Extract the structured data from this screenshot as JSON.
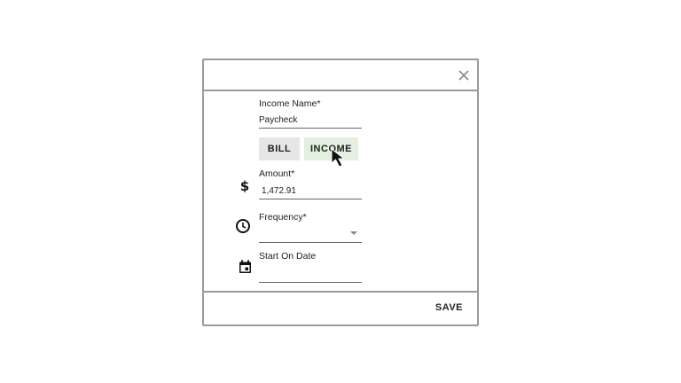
{
  "dialog": {
    "income_name": {
      "label": "Income Name*",
      "value": "Paycheck"
    },
    "type_toggle": {
      "bill_label": "BILL",
      "income_label": "INCOME",
      "selected": "INCOME"
    },
    "amount": {
      "label": "Amount*",
      "value": "1,472.91",
      "icon": "dollar-icon"
    },
    "frequency": {
      "label": "Frequency*",
      "value": "",
      "icon": "clock-icon"
    },
    "start_date": {
      "label": "Start On Date",
      "value": "",
      "icon": "calendar-icon"
    },
    "save_label": "SAVE",
    "close_icon": "close-icon"
  },
  "colors": {
    "border": "#9a9a9a",
    "bill_bg": "#e6e6e6",
    "income_bg": "#e3efdf"
  }
}
